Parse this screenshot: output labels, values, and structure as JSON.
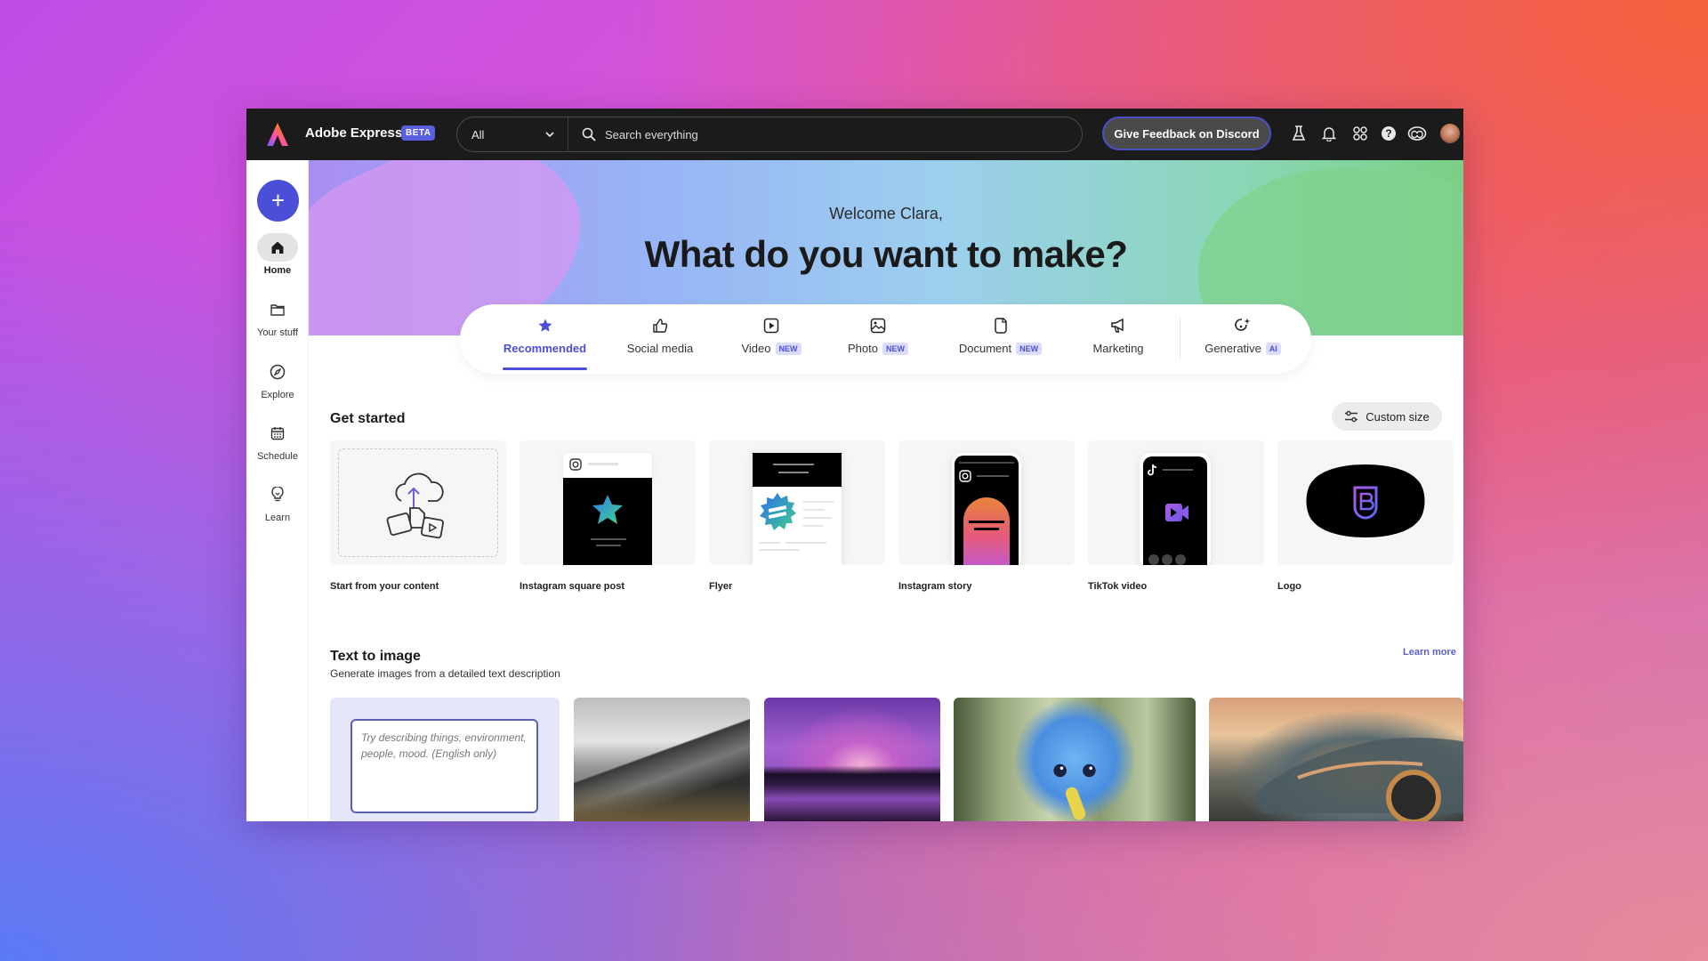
{
  "app": {
    "title": "Adobe Express",
    "badge": "BETA"
  },
  "topbar": {
    "filter_value": "All",
    "search_placeholder": "Search everything",
    "feedback_button": "Give Feedback on Discord",
    "icons": [
      "labs-flask-icon",
      "bell-icon",
      "apps-grid-icon",
      "help-icon",
      "creative-cloud-icon",
      "avatar"
    ]
  },
  "sidebar": {
    "create_label": "+",
    "items": [
      {
        "label": "Home",
        "icon": "home-icon",
        "active": true
      },
      {
        "label": "Your stuff",
        "icon": "folder-icon",
        "active": false
      },
      {
        "label": "Explore",
        "icon": "compass-icon",
        "active": false
      },
      {
        "label": "Schedule",
        "icon": "calendar-icon",
        "active": false
      },
      {
        "label": "Learn",
        "icon": "lightbulb-icon",
        "active": false
      }
    ]
  },
  "hero": {
    "welcome": "Welcome Clara,",
    "headline": "What do you want to make?"
  },
  "tabs": [
    {
      "label": "Recommended",
      "icon": "star-icon",
      "badge": null,
      "active": true
    },
    {
      "label": "Social media",
      "icon": "thumbs-up-icon",
      "badge": null,
      "active": false
    },
    {
      "label": "Video",
      "icon": "video-play-icon",
      "badge": "NEW",
      "active": false
    },
    {
      "label": "Photo",
      "icon": "photo-icon",
      "badge": "NEW",
      "active": false
    },
    {
      "label": "Document",
      "icon": "document-icon",
      "badge": "NEW",
      "active": false
    },
    {
      "label": "Marketing",
      "icon": "megaphone-icon",
      "badge": null,
      "active": false
    },
    {
      "label": "Generative",
      "icon": "generative-sparkle-icon",
      "badge": "AI",
      "active": false
    }
  ],
  "get_started": {
    "title": "Get started",
    "custom_size_label": "Custom size",
    "cards": [
      {
        "label": "Start from your content"
      },
      {
        "label": "Instagram square post"
      },
      {
        "label": "Flyer"
      },
      {
        "label": "Instagram story"
      },
      {
        "label": "TikTok video"
      },
      {
        "label": "Logo"
      }
    ]
  },
  "text_to_image": {
    "title": "Text to image",
    "subtitle": "Generate images from a detailed text description",
    "learn_more": "Learn more",
    "prompt_placeholder": "Try describing things, environment, people, mood. (English only)",
    "examples": [
      {
        "alt": "Black and white mountain range"
      },
      {
        "alt": "Purple sunset over a lake"
      },
      {
        "alt": "Fluffy blue creature holding a banana"
      },
      {
        "alt": "Futuristic sports car at sunset"
      }
    ]
  },
  "colors": {
    "accent": "#4b4fd8",
    "topbar_bg": "#1b1b1b",
    "badge_bg": "#dcdcff"
  }
}
